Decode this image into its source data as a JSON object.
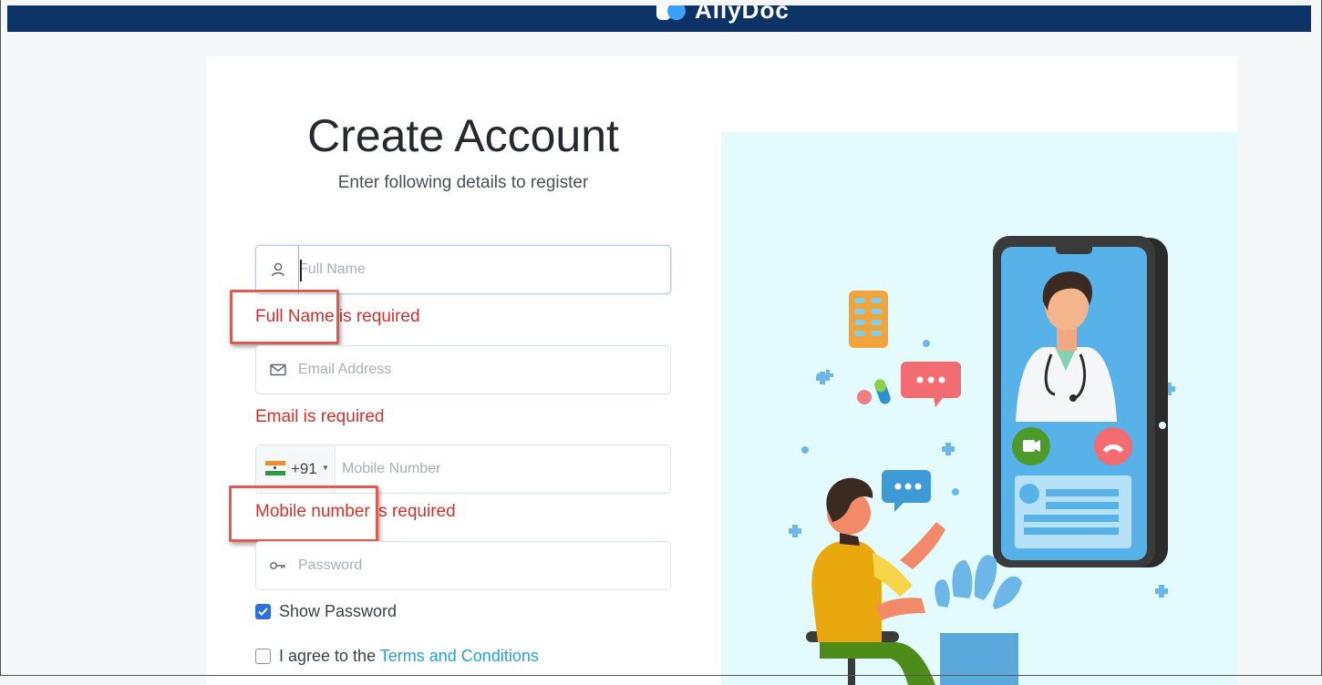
{
  "header": {
    "brand_name": "AllyDoc",
    "color": "#0d3366"
  },
  "form": {
    "title": "Create Account",
    "subtitle": "Enter following details to register",
    "full_name": {
      "placeholder": "Full Name",
      "value": "",
      "error": "Full Name is required"
    },
    "email": {
      "placeholder": "Email Address",
      "value": "",
      "error": "Email is required"
    },
    "mobile": {
      "country_code": "+91",
      "placeholder": "Mobile Number",
      "value": "",
      "error": "Mobile number is required"
    },
    "password": {
      "placeholder": "Password",
      "value": ""
    },
    "show_password": {
      "label": "Show Password",
      "checked": true
    },
    "terms": {
      "prefix": "I agree to the ",
      "link": "Terms and Conditions",
      "checked": false
    }
  },
  "colors": {
    "error": "#d3322f",
    "link": "#2a9de0",
    "checkbox": "#2f6fd8",
    "illustration_bg": "#e3fbfc"
  },
  "icons": [
    "person-icon",
    "envelope-icon",
    "india-flag-icon",
    "key-icon",
    "checkmark-icon"
  ]
}
